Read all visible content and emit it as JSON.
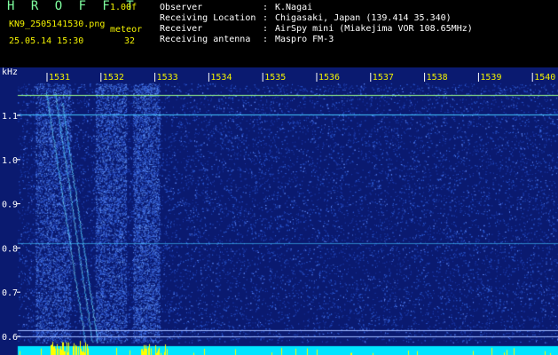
{
  "header": {
    "app_title": "H R O F F T",
    "version": "1.00f",
    "filename": "KN9_2505141530.png",
    "datetime": "25.05.14 15:30",
    "meteor_label": "meteor",
    "meteor_count": "32",
    "meta": [
      {
        "key": "Observer",
        "sep": ":",
        "value": "K.Nagai"
      },
      {
        "key": "Receiving Location",
        "sep": ":",
        "value": "Chigasaki, Japan (139.414 35.340)"
      },
      {
        "key": "Receiver",
        "sep": ":",
        "value": "AirSpy mini (Miakejima VOR 108.65MHz)"
      },
      {
        "key": "Receiving antenna",
        "sep": ":",
        "value": "Maspro FM-3"
      }
    ]
  },
  "plot": {
    "y_unit": "kHz",
    "y_ticks": [
      "1.1",
      "1.0",
      "0.9",
      "0.8",
      "0.7",
      "0.6"
    ],
    "x_ticks": [
      "1531",
      "1532",
      "1533",
      "1534",
      "1535",
      "1536",
      "1537",
      "1538",
      "1539",
      "1540"
    ],
    "colors": {
      "background": "#0a1a70",
      "noise": "#2f5fd8",
      "signal": "#44c8ff",
      "carrier": "#9cff8a",
      "baseline": "#00e5ff",
      "baseline_bursts": "#ffff00",
      "tick_label": "#f2f200",
      "axis_label": "#ffffff"
    }
  }
}
